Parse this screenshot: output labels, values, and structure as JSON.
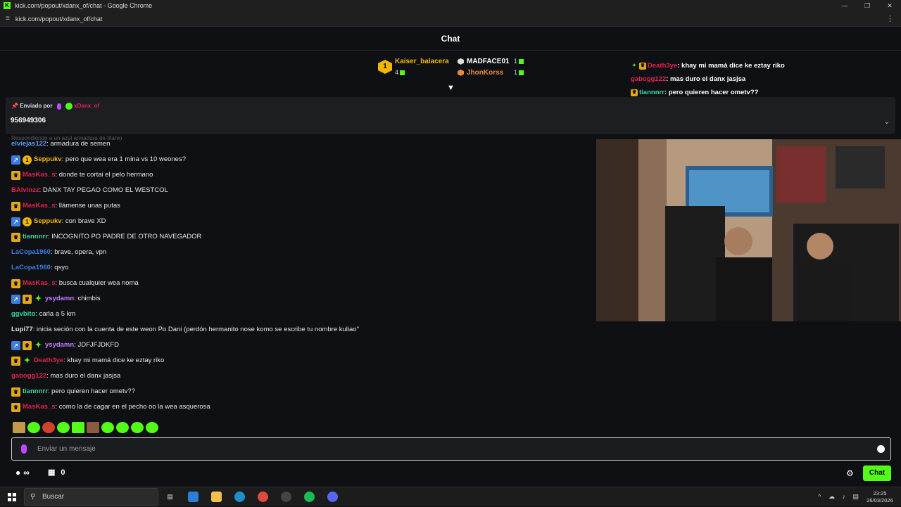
{
  "browser": {
    "title": "kick.com/popout/xdanx_of/chat - Google Chrome",
    "url": "kick.com/popout/xdanx_of/chat",
    "favicon_letter": "K"
  },
  "chat_header": {
    "title": "Chat"
  },
  "leaderboard": {
    "first": {
      "rank": "1",
      "name": "Kaiser_balacera",
      "count": "4"
    },
    "second": {
      "name": "MADFACE01",
      "count": "1"
    },
    "third": {
      "name": "JhonKorss",
      "count": "1"
    }
  },
  "pinned": {
    "label": "Enviado por",
    "author": "xDanx_of",
    "message": "956949306"
  },
  "faded_text": "Respondiendo a un azul armadura de titanio",
  "messages": [
    {
      "user": "elviejas122",
      "color": "#5d9cf4",
      "text": ": armadura de semen",
      "badges": []
    },
    {
      "user": "Seppukv",
      "color": "#f2b705",
      "text": ": pero que wea era 1 mina vs 10 weones?",
      "badges": [
        "arrow",
        "one"
      ]
    },
    {
      "user": "MasKas_s",
      "color": "#e0234e",
      "text": ": donde te cortai el pelo hermano",
      "badges": [
        "crown"
      ]
    },
    {
      "user": "BAlvinzz",
      "color": "#e0234e",
      "text": ": DANX TAY PEGAO COMO EL WESTCOL",
      "badges": []
    },
    {
      "user": "MasKas_s",
      "color": "#e0234e",
      "text": ": llámense unas putas",
      "badges": [
        "crown"
      ]
    },
    {
      "user": "Seppukv",
      "color": "#f2b705",
      "text": ": con brave XD",
      "badges": [
        "arrow",
        "one"
      ]
    },
    {
      "user": "tiannnrr",
      "color": "#3bd6a0",
      "text": ": INCOGNITO PO PADRE DE OTRO NAVEGADOR",
      "badges": [
        "crown"
      ]
    },
    {
      "user": "LaCopa1960",
      "color": "#3d7de0",
      "text": ": brave, opera, vpn",
      "badges": []
    },
    {
      "user": "LaCopa1960",
      "color": "#3d7de0",
      "text": ": qsyo",
      "badges": []
    },
    {
      "user": "MasKas_s",
      "color": "#e0234e",
      "text": ": busca cualquier wea noma",
      "badges": [
        "crown"
      ]
    },
    {
      "user": "ysydamn",
      "color": "#c47cff",
      "text": ": chimbis",
      "badges": [
        "arrow",
        "crown",
        "star"
      ]
    },
    {
      "user": "ggvbito",
      "color": "#3bd6a0",
      "text": ": carla a 5 km",
      "badges": []
    },
    {
      "user": "Lupi77",
      "color": "#e8e8e8",
      "text": ": inicia seción con la cuenta de este weon Po Dani (perdón hermanito nose komo se escribe tu nombre kuliao\"",
      "badges": []
    },
    {
      "user": "ysydamn",
      "color": "#c47cff",
      "text": ": JDFJFJDKFD",
      "badges": [
        "arrow",
        "crown",
        "star"
      ]
    },
    {
      "user": "Death3ye",
      "color": "#e0234e",
      "text": ": khay mi mamá dice ke eztay riko",
      "badges": [
        "crown",
        "star"
      ]
    },
    {
      "user": "gabogg122",
      "color": "#e0234e",
      "text": ": mas duro el danx jasjsa",
      "badges": []
    },
    {
      "user": "tiannnrr",
      "color": "#3bd6a0",
      "text": ": pero quieren hacer ometv??",
      "badges": [
        "crown"
      ]
    },
    {
      "user": "MasKas_s",
      "color": "#e0234e",
      "text": ": como la de cagar en el pecho oo la wea asquerosa",
      "badges": [
        "crown"
      ]
    }
  ],
  "overlay_messages": [
    {
      "user": "Death3ye",
      "color": "#e0234e",
      "text": ": khay mi mamá dice ke eztay riko",
      "badges": [
        "star",
        "crown"
      ]
    },
    {
      "user": "gabogg122",
      "color": "#e0234e",
      "text": ": mas duro el danx jasjsa",
      "badges": []
    },
    {
      "user": "tiannnrr",
      "color": "#3bd6a0",
      "text": ": pero quieren hacer ometv??",
      "badges": [
        "crown"
      ]
    },
    {
      "user": "MasKas_s",
      "color": "#e0234e",
      "text": ": como la de cagar en el pecho oo la wea asquerosa",
      "badges": [
        "crown"
      ]
    }
  ],
  "input": {
    "placeholder": "Enviar un mensaje"
  },
  "bottom": {
    "points": "∞",
    "store_count": "0",
    "chat_button": "Chat"
  },
  "taskbar": {
    "search_placeholder": "Buscar",
    "time": "23:25",
    "date": "26/03/2026"
  },
  "colors": {
    "accent": "#53fc18",
    "background": "#0f1014"
  }
}
